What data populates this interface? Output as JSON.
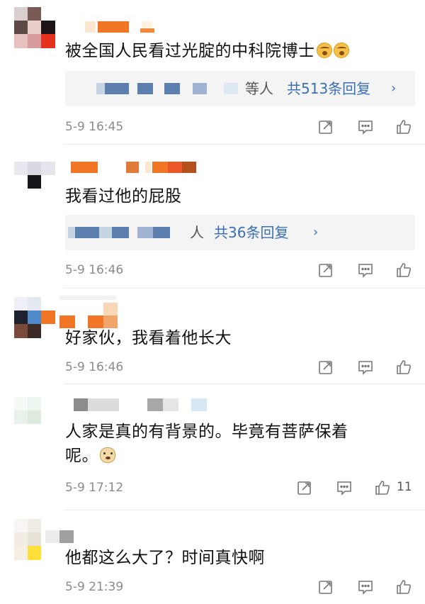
{
  "comments": [
    {
      "text": "被全国人民看过光腚的中科院博士",
      "emoji": [
        "wow-face-icon",
        "wow-face-icon"
      ],
      "reply_suffix": "等人",
      "reply_count_label": "共513条回复",
      "timestamp": "5-9 16:45",
      "likes": ""
    },
    {
      "text": "我看过他的屁股",
      "reply_suffix": "人",
      "reply_count_label": "共36条回复",
      "timestamp": "5-9 16:46",
      "likes": ""
    },
    {
      "text": "好家伙，我看着他长大",
      "timestamp": "5-9 16:46",
      "likes": ""
    },
    {
      "text_line1": "人家是真的有背景的。毕竟有菩萨保着",
      "text_line2": "呢。",
      "emoji": [
        "doge-face-icon"
      ],
      "timestamp": "5-9 17:12",
      "likes": "11"
    },
    {
      "text": "他都这么大了？时间真快啊",
      "timestamp": "5-9 21:39",
      "likes": ""
    }
  ],
  "colors": {
    "reply_link": "#3a6fb5",
    "timestamp": "#8b8b8b",
    "reply_box_bg": "#f4f4f4",
    "icon_stroke": "#777777"
  }
}
